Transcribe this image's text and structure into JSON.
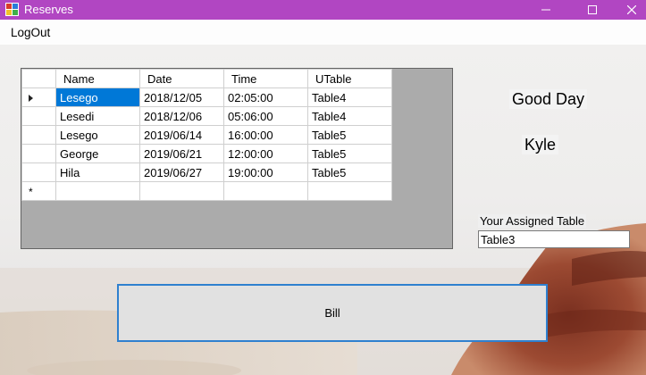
{
  "window": {
    "title": "Reserves"
  },
  "menu": {
    "logout": "LogOut"
  },
  "grid": {
    "columns": [
      "Name",
      "Date",
      "Time",
      "UTable"
    ],
    "rows": [
      [
        "Lesego",
        "2018/12/05",
        "02:05:00",
        "Table4"
      ],
      [
        "Lesedi",
        "2018/12/06",
        "05:06:00",
        "Table4"
      ],
      [
        "Lesego",
        "2019/06/14",
        "16:00:00",
        "Table5"
      ],
      [
        "George",
        "2019/06/21",
        "12:00:00",
        "Table5"
      ],
      [
        "Hila",
        "2019/06/27",
        "19:00:00",
        "Table5"
      ]
    ],
    "new_row_marker": "*"
  },
  "greeting": {
    "line1": "Good Day",
    "name": "Kyle"
  },
  "assigned": {
    "label": "Your Assigned Table",
    "value": "Table3"
  },
  "bill_button": {
    "label": "Bill"
  },
  "colors": {
    "titlebar": "#b146c2",
    "selection": "#0078d7",
    "button_border": "#2f80cf"
  }
}
